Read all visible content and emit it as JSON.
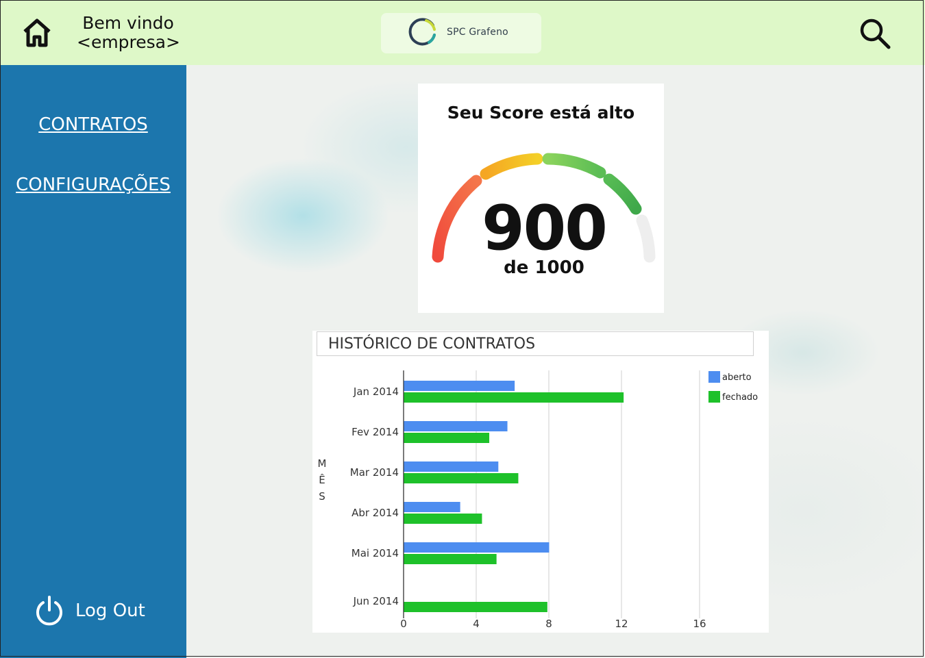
{
  "header": {
    "welcome_line1": "Bem vindo",
    "welcome_line2": "<empresa>",
    "brand_name": "SPC Grafeno",
    "home_icon": "home-icon",
    "search_icon": "search-icon"
  },
  "sidebar": {
    "items": [
      {
        "label": "CONTRATOS"
      },
      {
        "label": "CONFIGURAÇÕES"
      }
    ],
    "logout_label": "Log Out",
    "logout_icon": "power-icon",
    "background": "#1c76ad"
  },
  "score": {
    "title": "Seu Score está alto",
    "value": "900",
    "max_text": "de 1000",
    "value_number": 900,
    "max_number": 1000
  },
  "chart_data": {
    "type": "bar",
    "orientation": "horizontal",
    "title": "HISTÓRICO DE CONTRATOS",
    "ylabel": "MÊS",
    "categories": [
      "Jan  2014",
      "Fev  2014",
      "Mar  2014",
      "Abr  2014",
      "Mai  2014",
      "Jun  2014"
    ],
    "series": [
      {
        "name": "aberto",
        "color": "#4d8df0",
        "values": [
          6.1,
          5.7,
          5.2,
          3.1,
          8.0,
          0
        ]
      },
      {
        "name": "fechado",
        "color": "#1ec12a",
        "values": [
          12.1,
          4.7,
          6.3,
          4.3,
          5.1,
          7.9
        ]
      }
    ],
    "xticks": [
      "0",
      "4",
      "8",
      "12",
      "16"
    ],
    "xlim": [
      0,
      16
    ],
    "grid": true,
    "legend": "top-right"
  },
  "colors": {
    "header_bg": "#def8c8",
    "sidebar_bg": "#1c76ad"
  }
}
